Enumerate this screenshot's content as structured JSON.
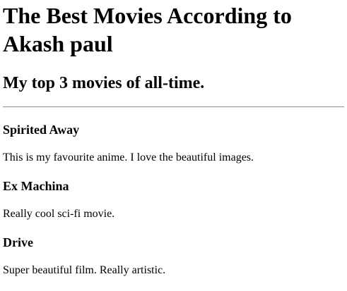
{
  "page": {
    "title": "The Best Movies According to Akash paul",
    "subtitle": "My top 3 movies of all-time."
  },
  "movies": [
    {
      "name": "Spirited Away",
      "description": "This is my favourite anime. I love the beautiful images."
    },
    {
      "name": "Ex Machina",
      "description": "Really cool sci-fi movie."
    },
    {
      "name": "Drive",
      "description": "Super beautiful film. Really artistic."
    }
  ]
}
